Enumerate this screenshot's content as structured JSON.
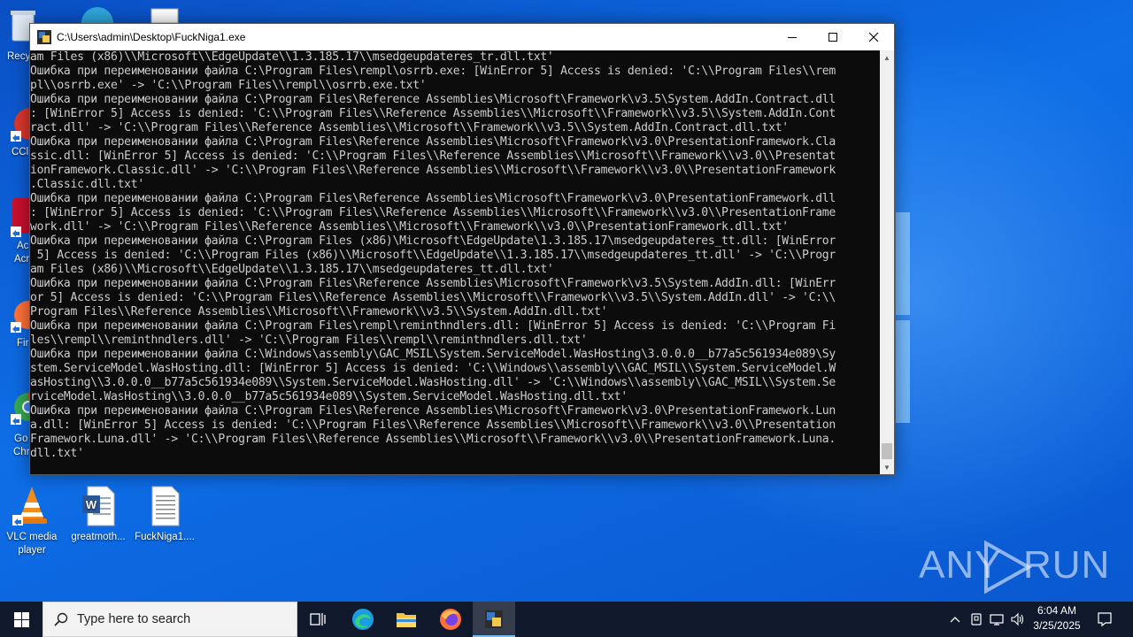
{
  "desktop": {
    "icons": [
      {
        "label": "VLC media player"
      },
      {
        "label": "greatmoth..."
      },
      {
        "label": "FuckNiga1...."
      }
    ],
    "partial_labels": [
      "Recy",
      "CCl",
      "Ac",
      "Acr",
      "Fir",
      "Go",
      "Chr"
    ]
  },
  "console": {
    "title": "C:\\Users\\admin\\Desktop\\FuckNiga1.exe",
    "lines": [
      "am Files (x86)\\\\Microsoft\\\\EdgeUpdate\\\\1.3.185.17\\\\msedgeupdateres_tr.dll.txt'",
      "Ошибка при переименовании файла C:\\Program Files\\rempl\\osrrb.exe: [WinError 5] Access is denied: 'C:\\\\Program Files\\\\rem",
      "pl\\\\osrrb.exe' -> 'C:\\\\Program Files\\\\rempl\\\\osrrb.exe.txt'",
      "Ошибка при переименовании файла C:\\Program Files\\Reference Assemblies\\Microsoft\\Framework\\v3.5\\System.AddIn.Contract.dll",
      ": [WinError 5] Access is denied: 'C:\\\\Program Files\\\\Reference Assemblies\\\\Microsoft\\\\Framework\\\\v3.5\\\\System.AddIn.Cont",
      "ract.dll' -> 'C:\\\\Program Files\\\\Reference Assemblies\\\\Microsoft\\\\Framework\\\\v3.5\\\\System.AddIn.Contract.dll.txt'",
      "Ошибка при переименовании файла C:\\Program Files\\Reference Assemblies\\Microsoft\\Framework\\v3.0\\PresentationFramework.Cla",
      "ssic.dll: [WinError 5] Access is denied: 'C:\\\\Program Files\\\\Reference Assemblies\\\\Microsoft\\\\Framework\\\\v3.0\\\\Presentat",
      "ionFramework.Classic.dll' -> 'C:\\\\Program Files\\\\Reference Assemblies\\\\Microsoft\\\\Framework\\\\v3.0\\\\PresentationFramework",
      ".Classic.dll.txt'",
      "Ошибка при переименовании файла C:\\Program Files\\Reference Assemblies\\Microsoft\\Framework\\v3.0\\PresentationFramework.dll",
      ": [WinError 5] Access is denied: 'C:\\\\Program Files\\\\Reference Assemblies\\\\Microsoft\\\\Framework\\\\v3.0\\\\PresentationFrame",
      "work.dll' -> 'C:\\\\Program Files\\\\Reference Assemblies\\\\Microsoft\\\\Framework\\\\v3.0\\\\PresentationFramework.dll.txt'",
      "Ошибка при переименовании файла C:\\Program Files (x86)\\Microsoft\\EdgeUpdate\\1.3.185.17\\msedgeupdateres_tt.dll: [WinError",
      " 5] Access is denied: 'C:\\\\Program Files (x86)\\\\Microsoft\\\\EdgeUpdate\\\\1.3.185.17\\\\msedgeupdateres_tt.dll' -> 'C:\\\\Progr",
      "am Files (x86)\\\\Microsoft\\\\EdgeUpdate\\\\1.3.185.17\\\\msedgeupdateres_tt.dll.txt'",
      "Ошибка при переименовании файла C:\\Program Files\\Reference Assemblies\\Microsoft\\Framework\\v3.5\\System.AddIn.dll: [WinErr",
      "or 5] Access is denied: 'C:\\\\Program Files\\\\Reference Assemblies\\\\Microsoft\\\\Framework\\\\v3.5\\\\System.AddIn.dll' -> 'C:\\\\",
      "Program Files\\\\Reference Assemblies\\\\Microsoft\\\\Framework\\\\v3.5\\\\System.AddIn.dll.txt'",
      "Ошибка при переименовании файла C:\\Program Files\\rempl\\reminthndlers.dll: [WinError 5] Access is denied: 'C:\\\\Program Fi",
      "les\\\\rempl\\\\reminthndlers.dll' -> 'C:\\\\Program Files\\\\rempl\\\\reminthndlers.dll.txt'",
      "Ошибка при переименовании файла C:\\Windows\\assembly\\GAC_MSIL\\System.ServiceModel.WasHosting\\3.0.0.0__b77a5c561934e089\\Sy",
      "stem.ServiceModel.WasHosting.dll: [WinError 5] Access is denied: 'C:\\\\Windows\\\\assembly\\\\GAC_MSIL\\\\System.ServiceModel.W",
      "asHosting\\\\3.0.0.0__b77a5c561934e089\\\\System.ServiceModel.WasHosting.dll' -> 'C:\\\\Windows\\\\assembly\\\\GAC_MSIL\\\\System.Se",
      "rviceModel.WasHosting\\\\3.0.0.0__b77a5c561934e089\\\\System.ServiceModel.WasHosting.dll.txt'",
      "Ошибка при переименовании файла C:\\Program Files\\Reference Assemblies\\Microsoft\\Framework\\v3.0\\PresentationFramework.Lun",
      "a.dll: [WinError 5] Access is denied: 'C:\\\\Program Files\\\\Reference Assemblies\\\\Microsoft\\\\Framework\\\\v3.0\\\\Presentation",
      "Framework.Luna.dll' -> 'C:\\\\Program Files\\\\Reference Assemblies\\\\Microsoft\\\\Framework\\\\v3.0\\\\PresentationFramework.Luna.",
      "dll.txt'"
    ]
  },
  "watermark": {
    "text_left": "ANY",
    "text_right": "RUN"
  },
  "taskbar": {
    "search_placeholder": "Type here to search",
    "time": "6:04 AM",
    "date": "3/25/2025"
  },
  "colors": {
    "accent": "#0b5fd1",
    "console_bg": "#0c0c0c",
    "console_text": "#cccccc"
  }
}
